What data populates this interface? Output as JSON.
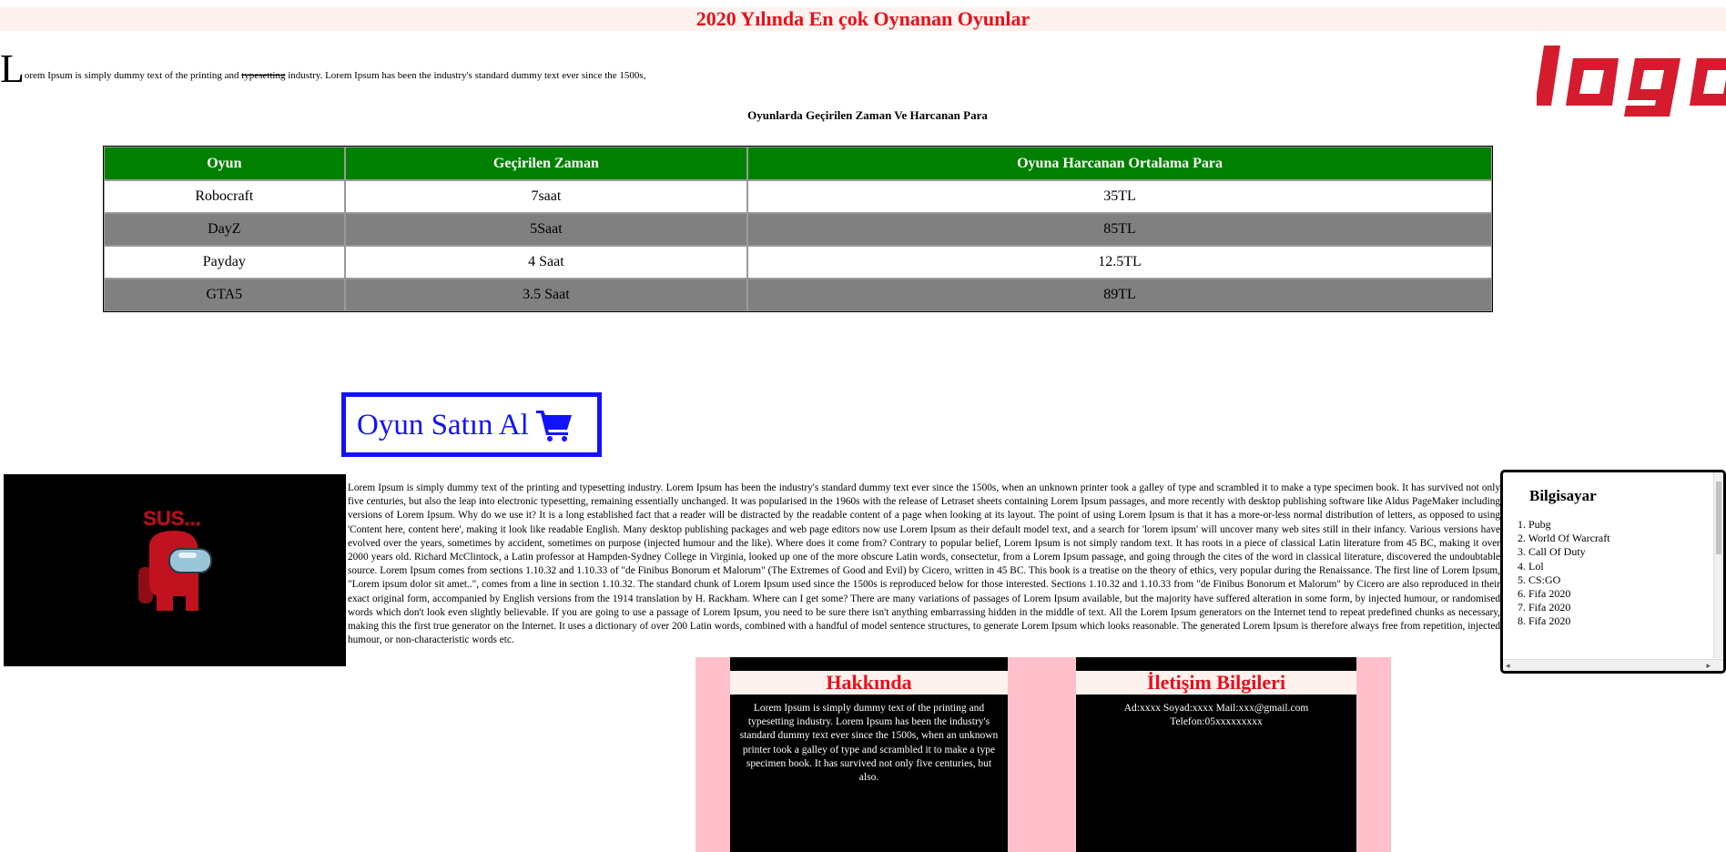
{
  "header": {
    "title": "2020 Yılında En çok Oynanan Oyunlar"
  },
  "intro": {
    "dropcap": "L",
    "text_before": "orem Ipsum is simply dummy text of the printing and ",
    "struck": "typesetting",
    "text_after": " industry. Lorem Ipsum has been the industry's standard dummy text ever since the 1500s,"
  },
  "logo": {
    "text": "logo",
    "color": "#d51c2f"
  },
  "table": {
    "caption": "Oyunlarda Geçirilen Zaman Ve Harcanan Para",
    "headers": [
      "Oyun",
      "Geçirilen Zaman",
      "Oyuna Harcanan Ortalama Para"
    ],
    "rows": [
      [
        "Robocraft",
        "7saat",
        "35TL"
      ],
      [
        "DayZ",
        "5Saat",
        "85TL"
      ],
      [
        "Payday",
        "4 Saat",
        "12.5TL"
      ],
      [
        "GTA5",
        "3.5 Saat",
        "89TL"
      ]
    ],
    "header_bg": "#008000",
    "alt_row_bg": "#808080"
  },
  "buy_button": {
    "label": "Oyun Satın Al",
    "icon": "shopping-cart-icon",
    "color": "#1212ff"
  },
  "image": {
    "text": "SUS...",
    "icon": "among-us-crewmate-icon"
  },
  "body_text": "Lorem Ipsum is simply dummy text of the printing and typesetting industry. Lorem Ipsum has been the industry's standard dummy text ever since the 1500s, when an unknown printer took a galley of type and scrambled it to make a type specimen book. It has survived not only five centuries, but also the leap into electronic typesetting, remaining essentially unchanged. It was popularised in the 1960s with the release of Letraset sheets containing Lorem Ipsum passages, and more recently with desktop publishing software like Aldus PageMaker including versions of Lorem Ipsum. Why do we use it? It is a long established fact that a reader will be distracted by the readable content of a page when looking at its layout. The point of using Lorem Ipsum is that it has a more-or-less normal distribution of letters, as opposed to using 'Content here, content here', making it look like readable English. Many desktop publishing packages and web page editors now use Lorem Ipsum as their default model text, and a search for 'lorem ipsum' will uncover many web sites still in their infancy. Various versions have evolved over the years, sometimes by accident, sometimes on purpose (injected humour and the like). Where does it come from? Contrary to popular belief, Lorem Ipsum is not simply random text. It has roots in a piece of classical Latin literature from 45 BC, making it over 2000 years old. Richard McClintock, a Latin professor at Hampden-Sydney College in Virginia, looked up one of the more obscure Latin words, consectetur, from a Lorem Ipsum passage, and going through the cites of the word in classical literature, discovered the undoubtable source. Lorem Ipsum comes from sections 1.10.32 and 1.10.33 of \"de Finibus Bonorum et Malorum\" (The Extremes of Good and Evil) by Cicero, written in 45 BC. This book is a treatise on the theory of ethics, very popular during the Renaissance. The first line of Lorem Ipsum, \"Lorem ipsum dolor sit amet..\", comes from a line in section 1.10.32. The standard chunk of Lorem Ipsum used since the 1500s is reproduced below for those interested. Sections 1.10.32 and 1.10.33 from \"de Finibus Bonorum et Malorum\" by Cicero are also reproduced in their exact original form, accompanied by English versions from the 1914 translation by H. Rackham. Where can I get some? There are many variations of passages of Lorem Ipsum available, but the majority have suffered alteration in some form, by injected humour, or randomised words which don't look even slightly believable. If you are going to use a passage of Lorem Ipsum, you need to be sure there isn't anything embarrassing hidden in the middle of text. All the Lorem Ipsum generators on the Internet tend to repeat predefined chunks as necessary, making this the first true generator on the Internet. It uses a dictionary of over 200 Latin words, combined with a handful of model sentence structures, to generate Lorem Ipsum which looks reasonable. The generated Lorem Ipsum is therefore always free from repetition, injected humour, or non-characteristic words etc.",
  "sidebar": {
    "heading": "Bilgisayar",
    "items": [
      "1. Pubg",
      "2. World Of Warcraft",
      "3. Call Of Duty",
      "4. Lol",
      "5. CS:GO",
      "6. Fifa 2020",
      "7. Fifa 2020",
      "8. Fifa 2020"
    ],
    "scroll_left": "◂",
    "scroll_right": "▸"
  },
  "footer": {
    "about": {
      "title": "Hakkında",
      "text": "Lorem Ipsum is simply dummy text of the printing and typesetting industry. Lorem Ipsum has been the industry's standard dummy text ever since the 1500s, when an unknown printer took a galley of type and scrambled it to make a type specimen book. It has survived not only five centuries, but also."
    },
    "contact": {
      "title": "İletişim Bilgileri",
      "line1": "Ad:xxxx Soyad:xxxx Mail:xxx@gmail.com",
      "line2": "Telefon:05xxxxxxxxx"
    }
  }
}
